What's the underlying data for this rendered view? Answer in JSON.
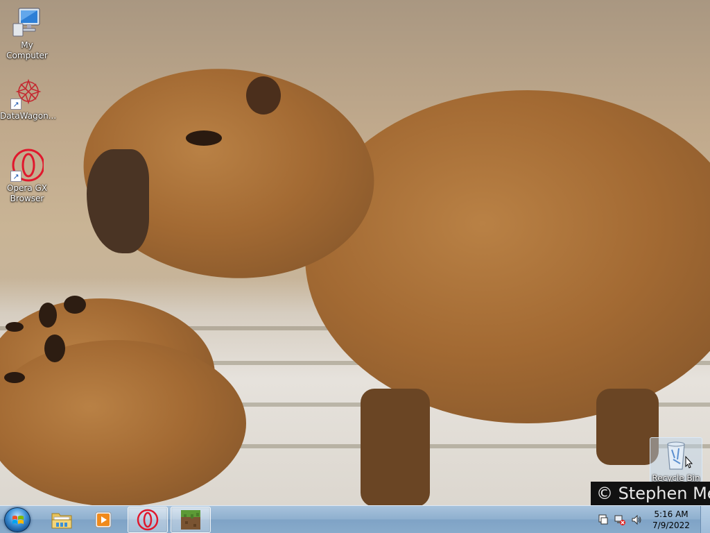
{
  "desktop_icons": [
    {
      "label": "My Computer",
      "icon": "computer-icon",
      "shortcut": false
    },
    {
      "label": "DataWagon...",
      "icon": "datawagon-icon",
      "shortcut": true
    },
    {
      "label": "Opera GX\nBrowser",
      "icon": "opera-gx-icon",
      "shortcut": true
    },
    {
      "label": "Recycle Bin",
      "icon": "recycle-bin-icon",
      "shortcut": false
    }
  ],
  "watermark": "© Stephen Me",
  "taskbar": {
    "start_label": "Start",
    "pinned": [
      {
        "name": "windows-explorer",
        "icon": "folder-icon"
      },
      {
        "name": "media-player",
        "icon": "media-player-icon"
      },
      {
        "name": "opera-gx",
        "icon": "opera-gx-icon",
        "active": true
      },
      {
        "name": "minecraft",
        "icon": "minecraft-icon"
      }
    ],
    "tray_icons": [
      "action-center-icon",
      "network-icon",
      "volume-icon"
    ],
    "clock": {
      "time": "5:16 AM",
      "date": "7/9/2022"
    }
  },
  "colors": {
    "taskbar": "#8fb0cf",
    "opera_red": "#e0182d"
  }
}
